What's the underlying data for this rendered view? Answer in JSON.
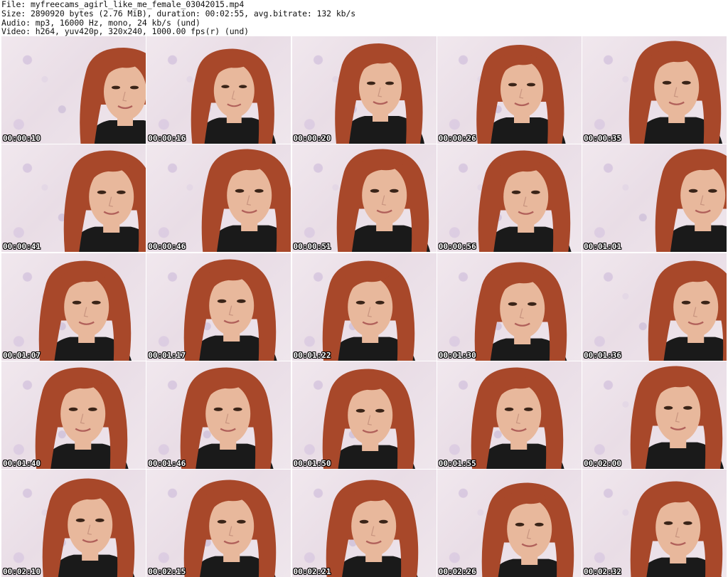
{
  "header": {
    "file_line": "File: myfreecams_agirl_like_me_female_03042015.mp4",
    "size_line": "Size: 2890920 bytes (2.76 MiB), duration: 00:02:55, avg.bitrate: 132 kb/s",
    "audio_line": "Audio: mp3, 16000 Hz, mono, 24 kb/s (und)",
    "video_line": "Video: h264, yuv420p, 320x240, 1000.00 fps(r) (und)"
  },
  "thumbnails": [
    {
      "timestamp": "00:00:10"
    },
    {
      "timestamp": "00:00:16"
    },
    {
      "timestamp": "00:00:20"
    },
    {
      "timestamp": "00:00:26"
    },
    {
      "timestamp": "00:00:35"
    },
    {
      "timestamp": "00:00:41"
    },
    {
      "timestamp": "00:00:46"
    },
    {
      "timestamp": "00:00:51"
    },
    {
      "timestamp": "00:00:56"
    },
    {
      "timestamp": "00:01:01"
    },
    {
      "timestamp": "00:01:07"
    },
    {
      "timestamp": "00:01:17"
    },
    {
      "timestamp": "00:01:22"
    },
    {
      "timestamp": "00:01:30"
    },
    {
      "timestamp": "00:01:36"
    },
    {
      "timestamp": "00:01:40"
    },
    {
      "timestamp": "00:01:46"
    },
    {
      "timestamp": "00:01:50"
    },
    {
      "timestamp": "00:01:55"
    },
    {
      "timestamp": "00:02:00"
    },
    {
      "timestamp": "00:02:10"
    },
    {
      "timestamp": "00:02:15"
    },
    {
      "timestamp": "00:02:21"
    },
    {
      "timestamp": "00:02:26"
    },
    {
      "timestamp": "00:02:32"
    }
  ],
  "colors": {
    "background": "#ffffff",
    "header_text": "#111111",
    "wallpaper": "#efe6ec",
    "hair": "#a8482a",
    "skin": "#e8b89c",
    "clothing": "#1a1a1a"
  }
}
